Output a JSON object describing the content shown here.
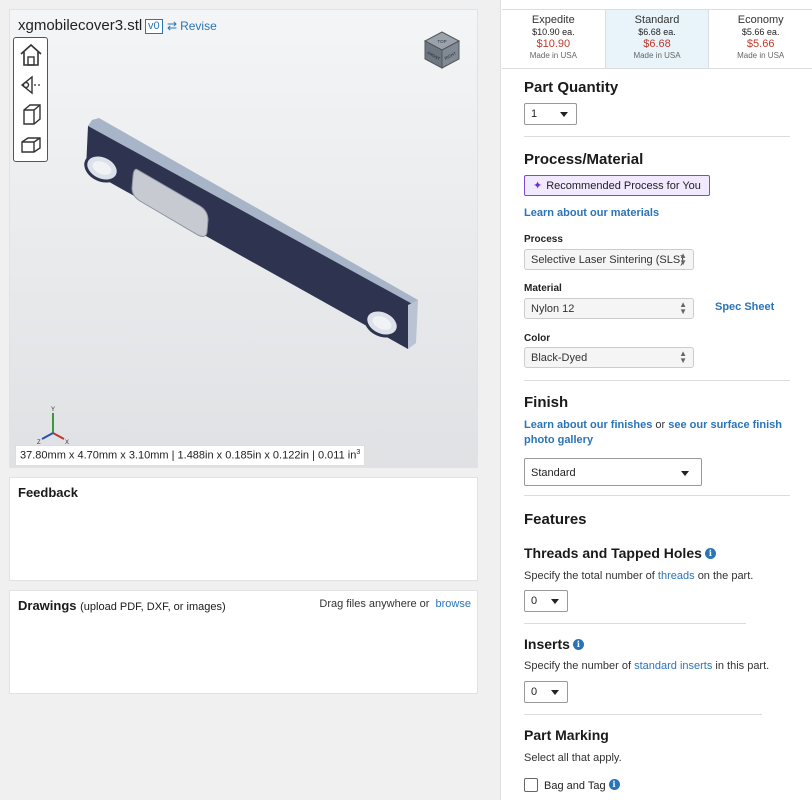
{
  "viewer": {
    "file_name": "xgmobilecover3.stl",
    "version": "v0",
    "revise_label": "Revise",
    "dimensions_text": "37.80mm x 4.70mm x 3.10mm | 1.488in x 0.185in x 0.122in | 0.011 in",
    "dimensions_exp": "3",
    "viewcube_front": "FRONT",
    "viewcube_right": "RIGHT",
    "viewcube_top": "TOP",
    "axis_labels": {
      "x": "X",
      "y": "Y",
      "z": "Z"
    }
  },
  "feedback": {
    "title": "Feedback"
  },
  "drawings": {
    "title": "Drawings",
    "subtitle": "(upload PDF, DXF, or images)",
    "drag_text": "Drag files anywhere or",
    "browse_label": "browse"
  },
  "tiers": [
    {
      "name": "Expedite",
      "each": "$10.90 ea.",
      "price": "$10.90",
      "made": "Made in USA"
    },
    {
      "name": "Standard",
      "each": "$6.68 ea.",
      "price": "$6.68",
      "made": "Made in USA"
    },
    {
      "name": "Economy",
      "each": "$5.66 ea.",
      "price": "$5.66",
      "made": "Made in USA"
    }
  ],
  "quantity": {
    "heading": "Part Quantity",
    "value": "1"
  },
  "process_material": {
    "heading": "Process/Material",
    "recommended_label": "Recommended Process for You",
    "learn_link": "Learn about our materials",
    "process_label": "Process",
    "process_value": "Selective Laser Sintering (SLS)",
    "material_label": "Material",
    "material_value": "Nylon 12",
    "spec_sheet": "Spec Sheet",
    "color_label": "Color",
    "color_value": "Black-Dyed"
  },
  "finish": {
    "heading": "Finish",
    "learn_link": "Learn about our finishes",
    "or_text": "or",
    "surface_link": "see our surface finish photo gallery",
    "value": "Standard"
  },
  "features": {
    "heading": "Features",
    "threads": {
      "heading": "Threads and Tapped Holes",
      "desc_pre": "Specify the total number of",
      "desc_link": "threads",
      "desc_post": "on the part.",
      "value": "0"
    },
    "inserts": {
      "heading": "Inserts",
      "desc_pre": "Specify the number of",
      "desc_link": "standard inserts",
      "desc_post": "in this part.",
      "value": "0"
    }
  },
  "marking": {
    "heading": "Part Marking",
    "desc": "Select all that apply.",
    "bag_label": "Bag and Tag"
  },
  "colors": {
    "accent": "#2a74b8",
    "price": "#c0392b",
    "part": "#2e3350",
    "recommended": "#7d4bd1"
  }
}
